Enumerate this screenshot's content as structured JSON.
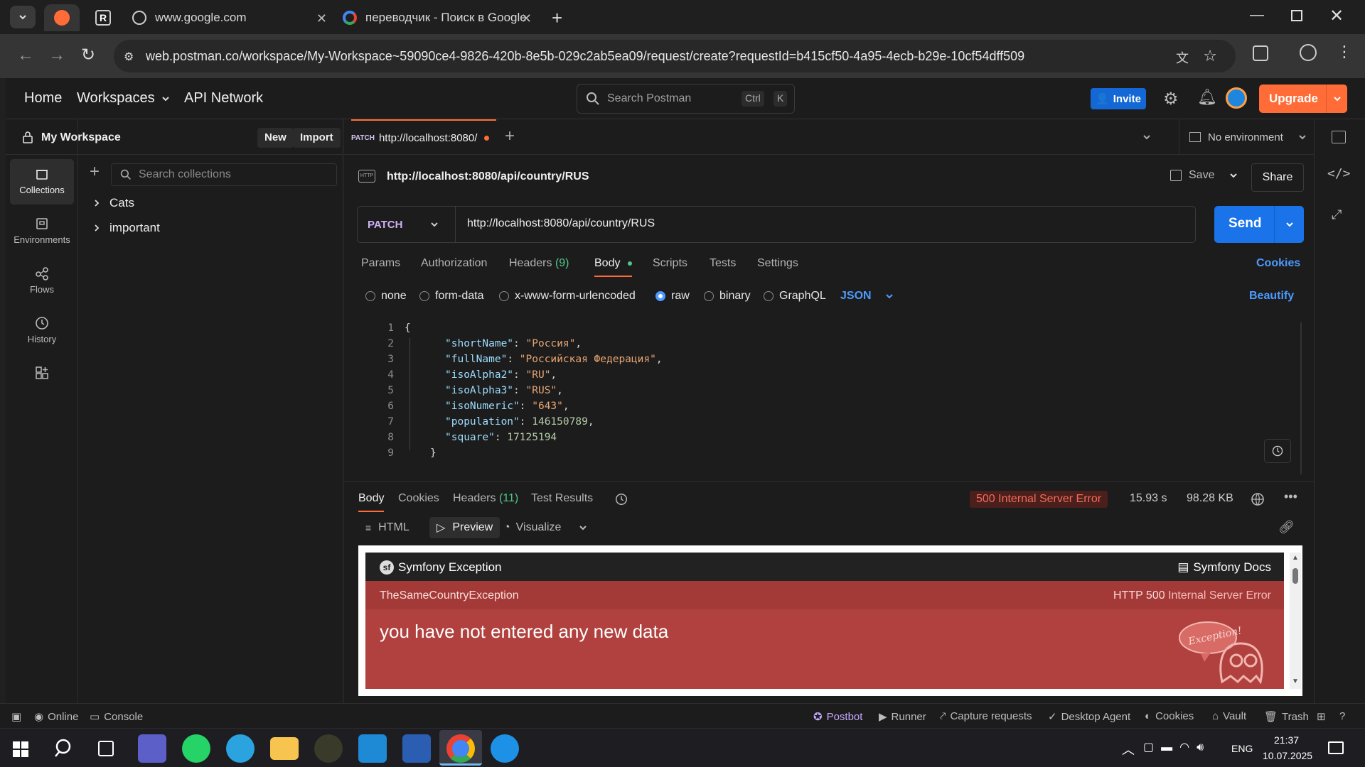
{
  "browser": {
    "tabs": [
      {
        "title": ""
      },
      {
        "title": ""
      },
      {
        "title": "www.google.com"
      },
      {
        "title": "переводчик - Поиск в Google"
      }
    ],
    "url": "web.postman.co/workspace/My-Workspace~59090ce4-9826-420b-8e5b-029c2ab5ea09/request/create?requestId=b415cf50-4a95-4ecb-b29e-10cf54dff509"
  },
  "topnav": {
    "home": "Home",
    "workspaces": "Workspaces",
    "api_network": "API Network",
    "search_placeholder": "Search Postman",
    "kbd_ctrl": "Ctrl",
    "kbd_k": "K",
    "invite": "Invite",
    "upgrade": "Upgrade"
  },
  "sidebar": {
    "workspace_name": "My Workspace",
    "new_btn": "New",
    "import_btn": "Import",
    "search_placeholder": "Search collections",
    "nav": [
      {
        "label": "Collections",
        "icon": "collections-icon"
      },
      {
        "label": "Environments",
        "icon": "environments-icon"
      },
      {
        "label": "Flows",
        "icon": "flows-icon"
      },
      {
        "label": "History",
        "icon": "history-icon"
      }
    ],
    "collections": [
      "Cats",
      "important"
    ]
  },
  "request_tab": {
    "method_badge": "PATCH",
    "title": "http://localhost:8080/",
    "environment": "No environment"
  },
  "request": {
    "name": "http://localhost:8080/api/country/RUS",
    "save": "Save",
    "share": "Share",
    "method": "PATCH",
    "url": "http://localhost:8080/api/country/RUS",
    "send": "Send",
    "tabs": {
      "params": "Params",
      "authorization": "Authorization",
      "headers": "Headers",
      "headers_count": "(9)",
      "body": "Body",
      "scripts": "Scripts",
      "tests": "Tests",
      "settings": "Settings",
      "cookies": "Cookies"
    },
    "body_modes": {
      "none": "none",
      "form_data": "form-data",
      "urlencoded": "x-www-form-urlencoded",
      "raw": "raw",
      "binary": "binary",
      "graphql": "GraphQL",
      "format": "JSON",
      "beautify": "Beautify"
    },
    "body_lines": [
      {
        "n": "1",
        "open": "{"
      },
      {
        "n": "2",
        "key": "\"shortName\"",
        "val": "\"Россия\"",
        "end": ","
      },
      {
        "n": "3",
        "key": "\"fullName\"",
        "val": "\"Российская Федерация\"",
        "end": ","
      },
      {
        "n": "4",
        "key": "\"isoAlpha2\"",
        "val": "\"RU\"",
        "end": ","
      },
      {
        "n": "5",
        "key": "\"isoAlpha3\"",
        "val": "\"RUS\"",
        "end": ","
      },
      {
        "n": "6",
        "key": "\"isoNumeric\"",
        "val": "\"643\"",
        "end": ","
      },
      {
        "n": "7",
        "key": "\"population\"",
        "val": "146150789",
        "end": ","
      },
      {
        "n": "8",
        "key": "\"square\"",
        "val": "17125194",
        "end": ""
      },
      {
        "n": "9",
        "close": "}"
      }
    ]
  },
  "response": {
    "tabs": {
      "body": "Body",
      "cookies": "Cookies",
      "headers": "Headers",
      "headers_count": "(11)",
      "test_results": "Test Results"
    },
    "status": "500 Internal Server Error",
    "time": "15.93 s",
    "size": "98.28 KB",
    "views": {
      "html": "HTML",
      "preview": "Preview",
      "visualize": "Visualize"
    },
    "symfony": {
      "header": "Symfony Exception",
      "docs": "Symfony Docs",
      "exception_class": "TheSameCountryException",
      "http_status": "HTTP 500",
      "http_status_text": "Internal Server Error",
      "message": "you have not entered any new data",
      "mascot_label": "Exception!"
    }
  },
  "statusbar": {
    "online": "Online",
    "console": "Console",
    "postbot": "Postbot",
    "runner": "Runner",
    "capture": "Capture requests",
    "agent": "Desktop Agent",
    "cookies": "Cookies",
    "vault": "Vault",
    "trash": "Trash"
  },
  "taskbar": {
    "lang": "ENG",
    "time": "21:37",
    "date": "10.07.2025"
  },
  "colors": {
    "accent": "#ff6c37",
    "send_blue": "#1a73e8",
    "error_red": "#b0413e"
  }
}
